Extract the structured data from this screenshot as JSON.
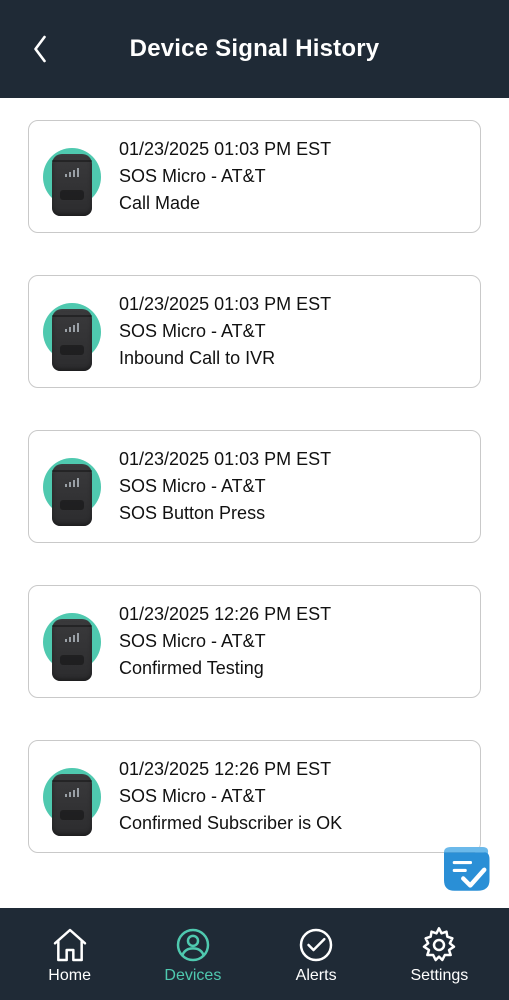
{
  "header": {
    "title": "Device Signal History"
  },
  "history": [
    {
      "timestamp": "01/23/2025 01:03 PM EST",
      "device": "SOS Micro - AT&T",
      "event": "Call Made"
    },
    {
      "timestamp": "01/23/2025 01:03 PM EST",
      "device": "SOS Micro - AT&T",
      "event": "Inbound Call to IVR"
    },
    {
      "timestamp": "01/23/2025 01:03 PM EST",
      "device": "SOS Micro - AT&T",
      "event": "SOS Button Press"
    },
    {
      "timestamp": "01/23/2025 12:26 PM EST",
      "device": "SOS Micro - AT&T",
      "event": "Confirmed Testing"
    },
    {
      "timestamp": "01/23/2025 12:26 PM EST",
      "device": "SOS Micro - AT&T",
      "event": "Confirmed Subscriber is OK"
    }
  ],
  "tabs": {
    "home": "Home",
    "devices": "Devices",
    "alerts": "Alerts",
    "settings": "Settings"
  },
  "colors": {
    "accent": "#4fc9af",
    "headerBg": "#1f2a36",
    "badge": "#2a8fd6"
  }
}
